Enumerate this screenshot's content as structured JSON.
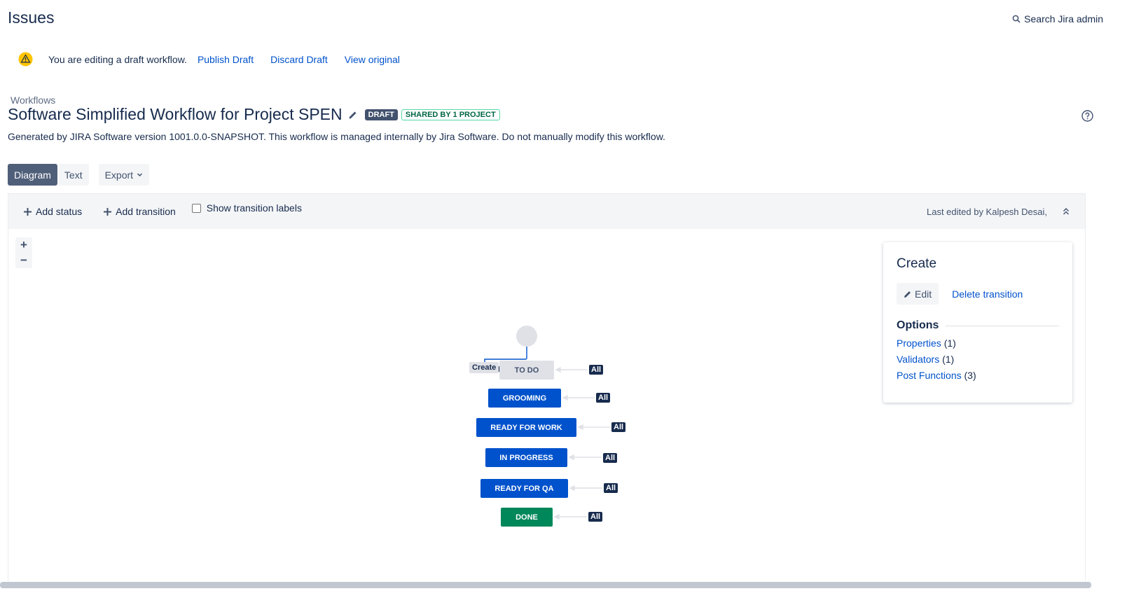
{
  "header": {
    "title": "Issues",
    "search_label": "Search Jira admin"
  },
  "banner": {
    "message": "You are editing a draft workflow.",
    "publish": "Publish Draft",
    "discard": "Discard Draft",
    "view_original": "View original"
  },
  "breadcrumb": "Workflows",
  "workflow": {
    "title": "Software Simplified Workflow for Project SPEN",
    "draft_badge": "DRAFT",
    "shared_badge": "SHARED BY 1 PROJECT",
    "description": "Generated by JIRA Software version 1001.0.0-SNAPSHOT. This workflow is managed internally by Jira Software. Do not manually modify this workflow."
  },
  "tabs": {
    "diagram": "Diagram",
    "text": "Text",
    "export": "Export"
  },
  "toolbar": {
    "add_status": "Add status",
    "add_transition": "Add transition",
    "show_labels": "Show transition labels",
    "last_edited": "Last edited by Kalpesh Desai,"
  },
  "zoom": {
    "in": "+",
    "out": "−"
  },
  "diagram": {
    "create_label": "Create",
    "all_label": "All",
    "statuses": [
      {
        "label": "TO DO",
        "category": "todo"
      },
      {
        "label": "GROOMING",
        "category": "in-progress"
      },
      {
        "label": "READY FOR WORK",
        "category": "in-progress"
      },
      {
        "label": "IN PROGRESS",
        "category": "in-progress"
      },
      {
        "label": "READY FOR QA",
        "category": "in-progress"
      },
      {
        "label": "DONE",
        "category": "done"
      }
    ]
  },
  "panel": {
    "title": "Create",
    "edit": "Edit",
    "delete": "Delete transition",
    "options_heading": "Options",
    "options": [
      {
        "label": "Properties",
        "count": "(1)"
      },
      {
        "label": "Validators",
        "count": "(1)"
      },
      {
        "label": "Post Functions",
        "count": "(3)"
      }
    ]
  },
  "colors": {
    "todo": "#dfe1e6",
    "in_progress": "#0052cc",
    "done": "#00875a",
    "link": "#0052cc"
  }
}
